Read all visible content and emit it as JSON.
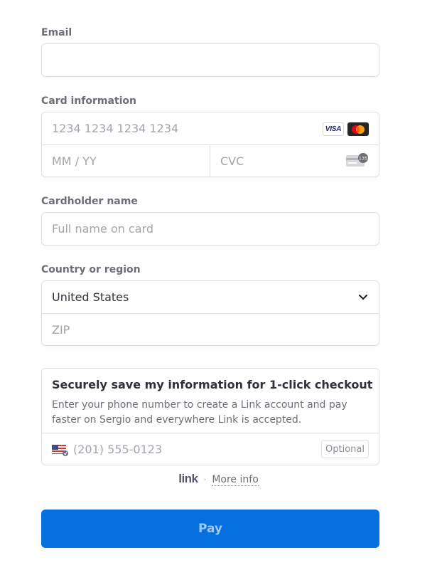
{
  "email": {
    "label": "Email",
    "value": ""
  },
  "card": {
    "label": "Card information",
    "number_placeholder": "1234 1234 1234 1234",
    "expiry_placeholder": "MM / YY",
    "cvc_placeholder": "CVC",
    "brands": [
      "VISA",
      "mastercard-icon"
    ],
    "visa_text": "VISA",
    "cvc_icon_text": "135"
  },
  "cardholder": {
    "label": "Cardholder name",
    "placeholder": "Full name on card"
  },
  "country": {
    "label": "Country or region",
    "selected": "United States",
    "zip_placeholder": "ZIP"
  },
  "link_save": {
    "title": "Securely save my information for 1-click checkout",
    "description": "Enter your phone number to create a Link account and pay faster on Sergio and everywhere Link is accepted.",
    "phone_placeholder": "(201) 555-0123",
    "optional_label": "Optional"
  },
  "footer": {
    "logo": "link",
    "separator": "·",
    "more_info": "More info"
  },
  "pay_button": {
    "label": "Pay",
    "color": "#0570de"
  }
}
